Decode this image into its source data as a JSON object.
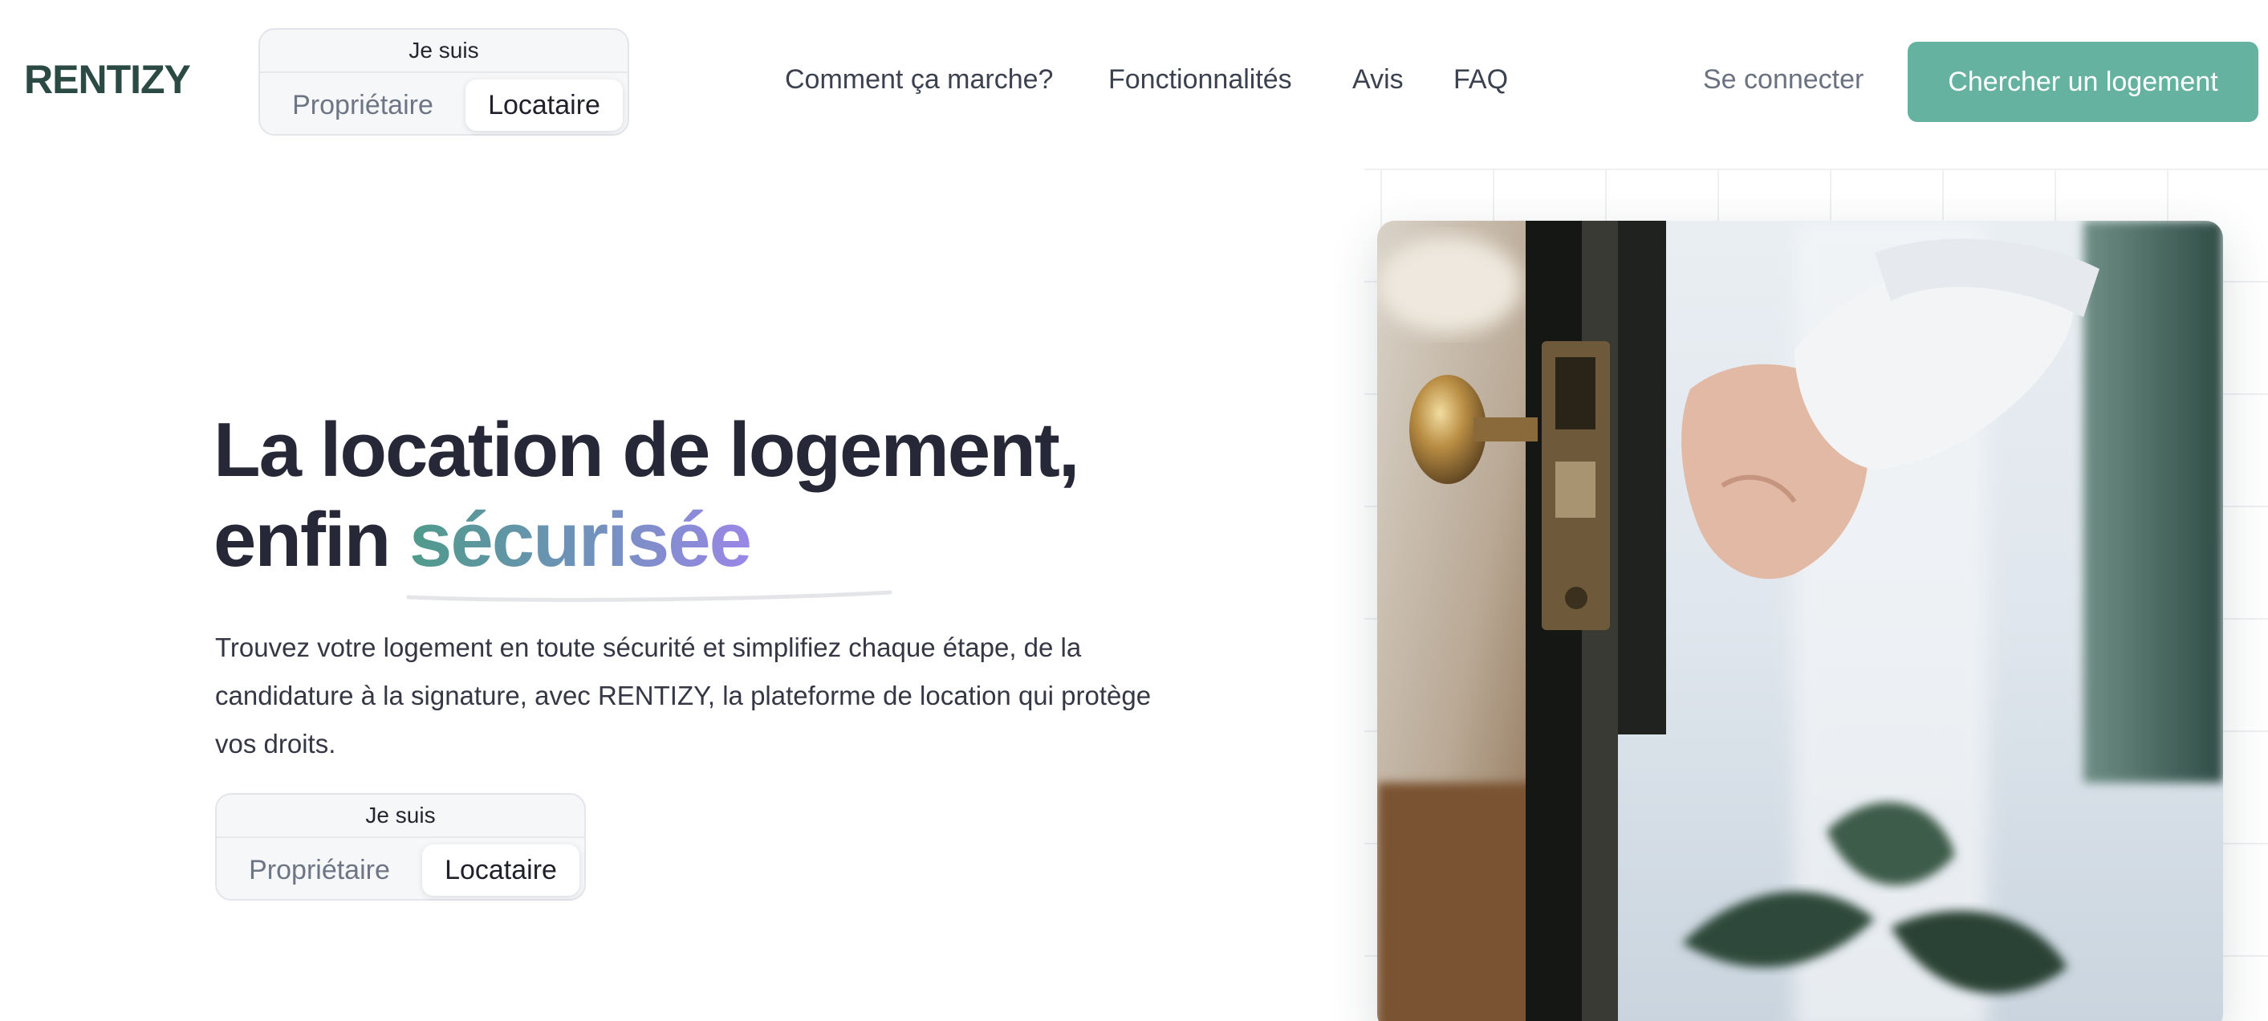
{
  "header": {
    "logo": "RENTIZY",
    "role_toggle": {
      "label": "Je suis",
      "options": [
        "Propriétaire",
        "Locataire"
      ],
      "selected": "Locataire"
    },
    "nav": [
      "Comment ça marche?",
      "Fonctionnalités",
      "Avis",
      "FAQ"
    ],
    "login": "Se connecter",
    "cta": "Chercher un logement"
  },
  "hero": {
    "headline_line1": "La location de logement,",
    "headline_line2_prefix": "enfin ",
    "headline_accent": "sécurisée",
    "subtext": "Trouvez votre logement en toute sécurité et simplifiez chaque étape, de la candidature à la signature, avec RENTIZY, la plateforme de location qui protège vos droits.",
    "role_toggle": {
      "label": "Je suis",
      "options": [
        "Propriétaire",
        "Locataire"
      ],
      "selected": "Locataire"
    },
    "image_alt": "door-opening-photo"
  },
  "colors": {
    "brand": "#2c4a44",
    "cta": "#64b29f",
    "accent_start": "#4f9a8b",
    "accent_end": "#9a87e7"
  }
}
